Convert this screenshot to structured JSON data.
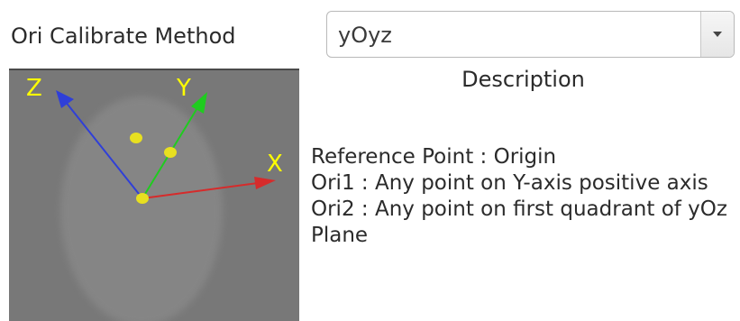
{
  "method": {
    "label": "Ori Calibrate Method",
    "selected_value": "yOyz"
  },
  "diagram": {
    "axis_labels": {
      "z": "Z",
      "y": "Y",
      "x": "X"
    },
    "colors": {
      "background": "#787878",
      "ellipse": "#848484",
      "axis_label": "#ffff00",
      "z_axis": "#2f3fd8",
      "y_axis": "#1fcc1f",
      "x_axis": "#d62b2b",
      "point": "#e8e020"
    }
  },
  "description": {
    "title": "Description",
    "lines": [
      "Reference Point : Origin",
      "Ori1 : Any point on Y-axis positive axis",
      "Ori2 : Any point on first quadrant of yOz Plane"
    ]
  }
}
